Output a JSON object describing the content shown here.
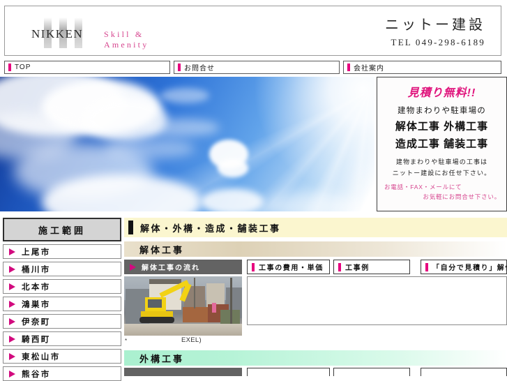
{
  "header": {
    "logo_text": "NIKKEN",
    "logo_tagline": "Skill  &  Amenity",
    "corp_name": "ニットー建設",
    "corp_tel": "TEL  049-298-6189"
  },
  "nav": {
    "items": [
      {
        "label": "TOP"
      },
      {
        "label": "お問合せ"
      },
      {
        "label": "会社案内"
      }
    ]
  },
  "promo": {
    "headline": "見積り無料!!",
    "line1": "建物まわりや駐車場の",
    "line2": "解体工事 外構工事",
    "line3": "造成工事 舗装工事",
    "line4": "建物まわりや駐車場の工事は",
    "line5": "ニットー建設にお任せ下さい。",
    "line6": "お電話・FAX・メールにて",
    "line7": "お気軽にお問合せ下さい。"
  },
  "sidebar": {
    "heading": "施工範囲",
    "items": [
      {
        "label": "上尾市"
      },
      {
        "label": "桶川市"
      },
      {
        "label": "北本市"
      },
      {
        "label": "鴻巣市"
      },
      {
        "label": "伊奈町"
      },
      {
        "label": "騎西町"
      },
      {
        "label": "東松山市"
      },
      {
        "label": "熊谷市"
      }
    ]
  },
  "main": {
    "title": "解体・外構・造成・舗装工事",
    "sections": [
      {
        "heading": "解体工事",
        "tabs": [
          {
            "label": "解体工事の流れ",
            "active": true
          },
          {
            "label": "工事の費用・単価",
            "active": false
          },
          {
            "label": "工事例",
            "active": false
          },
          {
            "label": "「自分で見積り」解体",
            "active": false
          }
        ],
        "note_star": "*",
        "note_exel": "EXEL)"
      },
      {
        "heading": "外構工事",
        "tabs": [
          {
            "label": "",
            "active": true
          },
          {
            "label": "",
            "active": false
          },
          {
            "label": "",
            "active": false
          },
          {
            "label": "",
            "active": false
          }
        ]
      }
    ]
  },
  "colors": {
    "accent_magenta": "#e6007e",
    "accent_pink": "#d6448e",
    "title_bg": "#fbf6cf",
    "sky_blue": "#2f74d8",
    "exterior_green": "#aaf0cf"
  }
}
